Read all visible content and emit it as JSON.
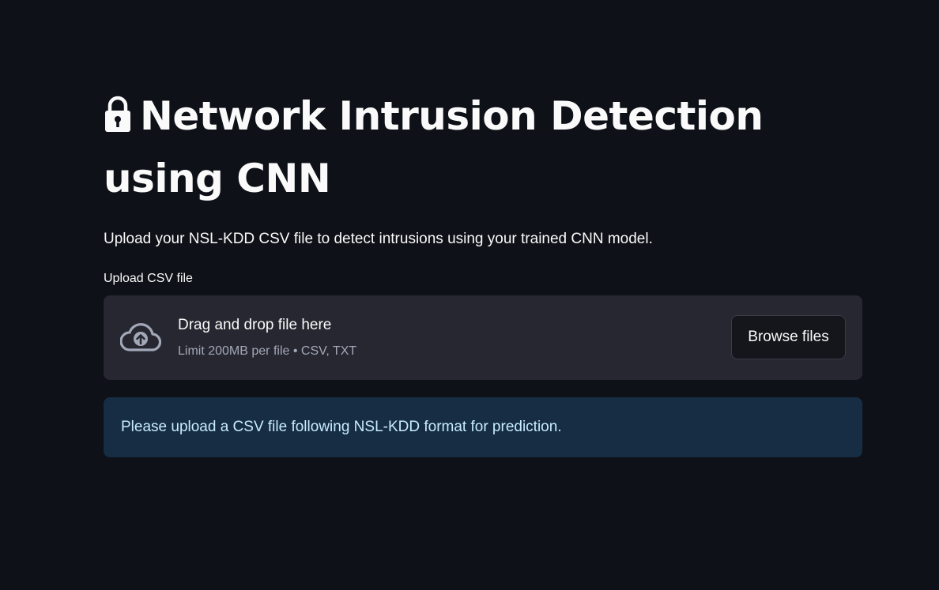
{
  "header": {
    "title": "Network Intrusion Detection using CNN",
    "title_icon": "lock-icon"
  },
  "main": {
    "subtitle": "Upload your NSL-KDD CSV file to detect intrusions using your trained CNN model."
  },
  "uploader": {
    "label": "Upload CSV file",
    "drop_text": "Drag and drop file here",
    "limit_text": "Limit 200MB per file • CSV, TXT",
    "browse_label": "Browse files",
    "icon": "cloud-upload-icon"
  },
  "info": {
    "message": "Please upload a CSV file following NSL-KDD format for prediction."
  },
  "colors": {
    "background": "#0e1117",
    "dropzone": "#262730",
    "info_bg": "#172d43",
    "info_text": "#c7ebff"
  }
}
